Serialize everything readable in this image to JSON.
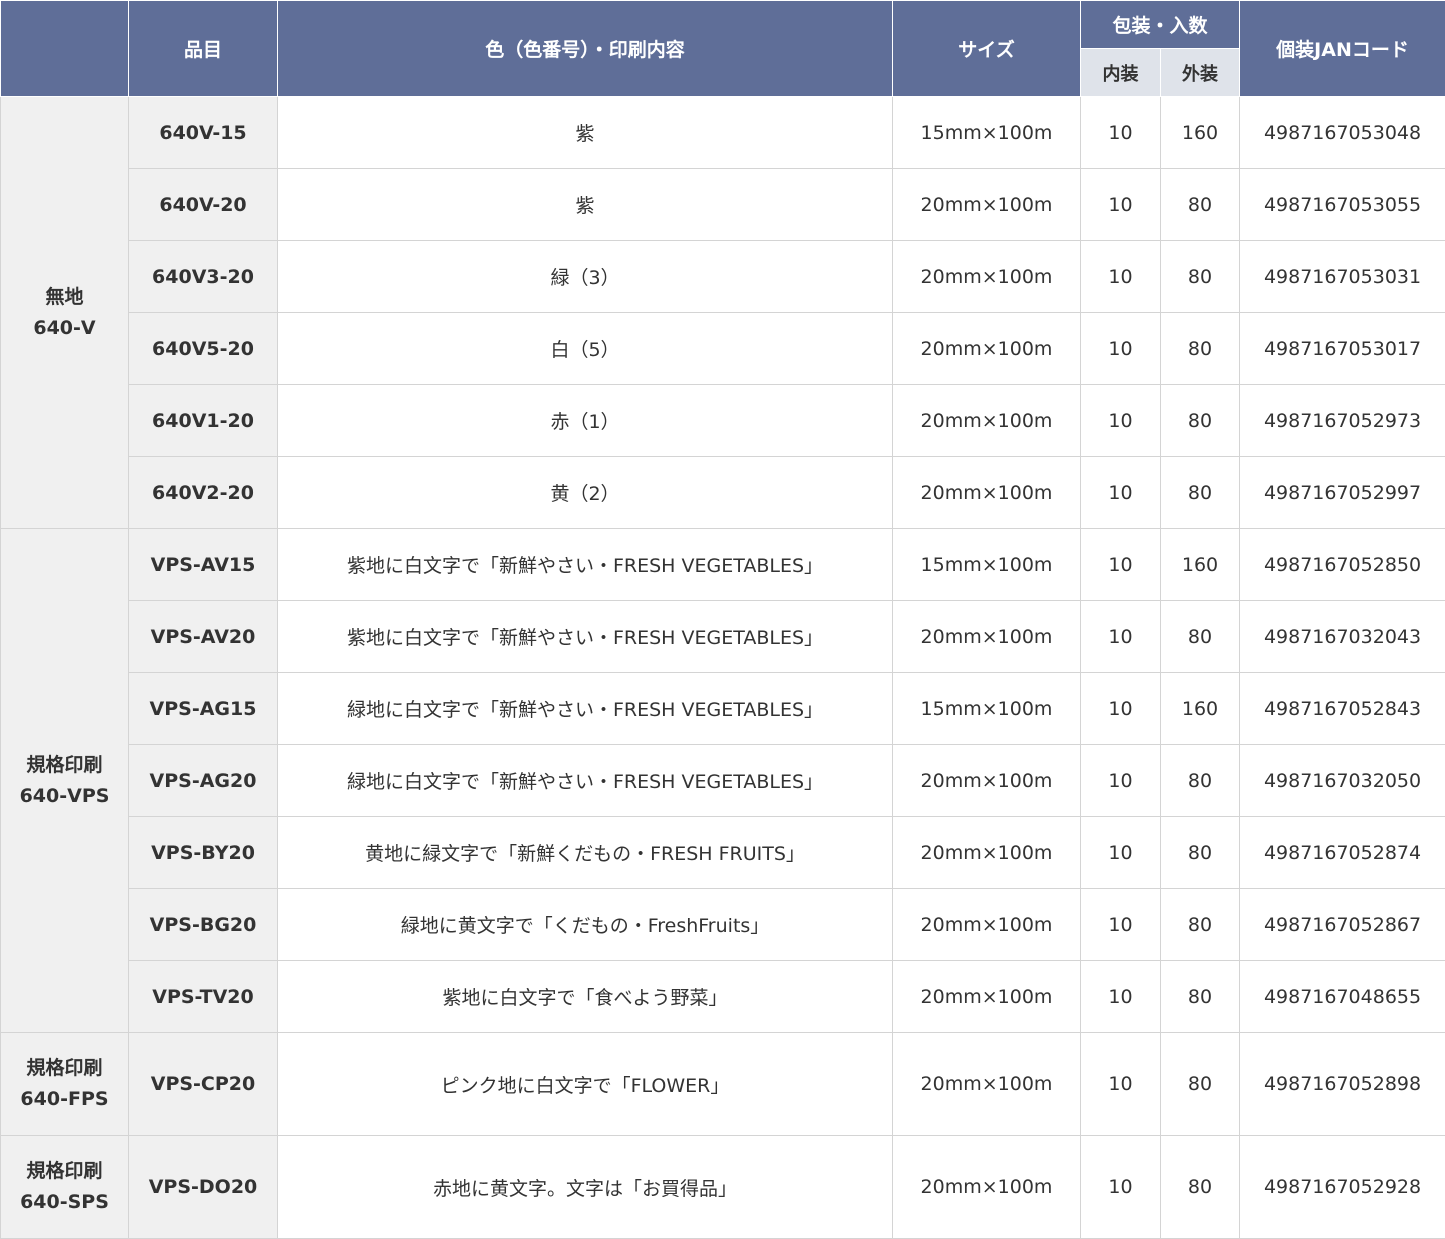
{
  "headers": {
    "item": "品目",
    "color": "色（色番号）・印刷内容",
    "size": "サイズ",
    "packing": "包装・入数",
    "inner": "内装",
    "outer": "外装",
    "jan": "個装JANコード"
  },
  "groups": [
    {
      "name": "無地",
      "code": "640-V"
    },
    {
      "name": "規格印刷",
      "code": "640-VPS"
    },
    {
      "name": "規格印刷",
      "code": "640-FPS"
    },
    {
      "name": "規格印刷",
      "code": "640-SPS"
    }
  ],
  "rows": [
    {
      "item": "640V-15",
      "color": "紫",
      "size": "15mm×100m",
      "inner": "10",
      "outer": "160",
      "jan": "4987167053048"
    },
    {
      "item": "640V-20",
      "color": "紫",
      "size": "20mm×100m",
      "inner": "10",
      "outer": "80",
      "jan": "4987167053055"
    },
    {
      "item": "640V3-20",
      "color": "緑（3）",
      "size": "20mm×100m",
      "inner": "10",
      "outer": "80",
      "jan": "4987167053031"
    },
    {
      "item": "640V5-20",
      "color": "白（5）",
      "size": "20mm×100m",
      "inner": "10",
      "outer": "80",
      "jan": "4987167053017"
    },
    {
      "item": "640V1-20",
      "color": "赤（1）",
      "size": "20mm×100m",
      "inner": "10",
      "outer": "80",
      "jan": "4987167052973"
    },
    {
      "item": "640V2-20",
      "color": "黄（2）",
      "size": "20mm×100m",
      "inner": "10",
      "outer": "80",
      "jan": "4987167052997"
    },
    {
      "item": "VPS-AV15",
      "color": "紫地に白文字で「新鮮やさい・FRESH VEGETABLES」",
      "size": "15mm×100m",
      "inner": "10",
      "outer": "160",
      "jan": "4987167052850"
    },
    {
      "item": "VPS-AV20",
      "color": "紫地に白文字で「新鮮やさい・FRESH VEGETABLES」",
      "size": "20mm×100m",
      "inner": "10",
      "outer": "80",
      "jan": "4987167032043"
    },
    {
      "item": "VPS-AG15",
      "color": "緑地に白文字で「新鮮やさい・FRESH VEGETABLES」",
      "size": "15mm×100m",
      "inner": "10",
      "outer": "160",
      "jan": "4987167052843"
    },
    {
      "item": "VPS-AG20",
      "color": "緑地に白文字で「新鮮やさい・FRESH VEGETABLES」",
      "size": "20mm×100m",
      "inner": "10",
      "outer": "80",
      "jan": "4987167032050"
    },
    {
      "item": "VPS-BY20",
      "color": "黄地に緑文字で「新鮮くだもの・FRESH FRUITS」",
      "size": "20mm×100m",
      "inner": "10",
      "outer": "80",
      "jan": "4987167052874"
    },
    {
      "item": "VPS-BG20",
      "color": "緑地に黄文字で「くだもの・FreshFruits」",
      "size": "20mm×100m",
      "inner": "10",
      "outer": "80",
      "jan": "4987167052867"
    },
    {
      "item": "VPS-TV20",
      "color": "紫地に白文字で「食べよう野菜」",
      "size": "20mm×100m",
      "inner": "10",
      "outer": "80",
      "jan": "4987167048655"
    },
    {
      "item": "VPS-CP20",
      "color": "ピンク地に白文字で「FLOWER」",
      "size": "20mm×100m",
      "inner": "10",
      "outer": "80",
      "jan": "4987167052898"
    },
    {
      "item": "VPS-DO20",
      "color": "赤地に黄文字。文字は「お買得品」",
      "size": "20mm×100m",
      "inner": "10",
      "outer": "80",
      "jan": "4987167052928"
    }
  ],
  "colors": {
    "header_bg": "#5f6e98",
    "subheader_bg": "#dfe3ea",
    "label_bg": "#f0f0f0"
  }
}
